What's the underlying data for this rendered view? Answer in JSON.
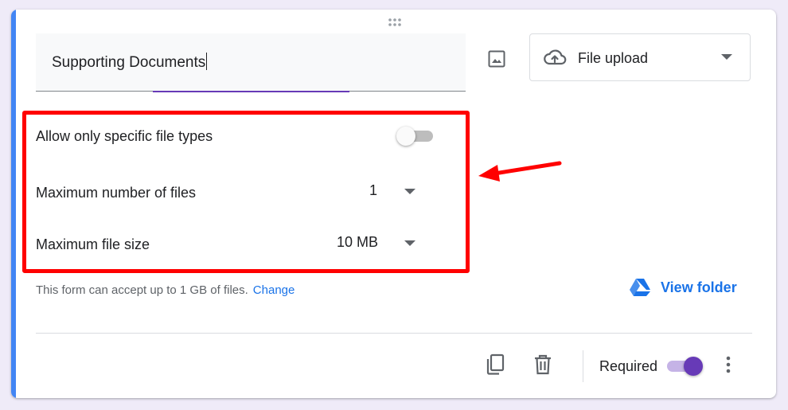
{
  "colors": {
    "accent_bar": "#4285f4",
    "primary": "#673ab7",
    "link": "#1a73e8",
    "annotation": "#ff0000"
  },
  "question": {
    "title_value": "Supporting Documents",
    "image_icon": "image-icon"
  },
  "type_select": {
    "icon": "cloud-upload-icon",
    "label": "File upload"
  },
  "settings": {
    "specific_types": {
      "label": "Allow only specific file types",
      "enabled": false
    },
    "max_files": {
      "label": "Maximum number of files",
      "value": "1"
    },
    "max_size": {
      "label": "Maximum file size",
      "value": "10 MB"
    }
  },
  "hint": {
    "text": "This form can accept up to 1 GB of files.",
    "link": "Change"
  },
  "view_folder": {
    "icon": "google-drive-icon",
    "label": "View folder"
  },
  "footer": {
    "duplicate_icon": "copy-icon",
    "delete_icon": "trash-icon",
    "required_label": "Required",
    "required_enabled": true,
    "more_icon": "more-vert-icon"
  }
}
